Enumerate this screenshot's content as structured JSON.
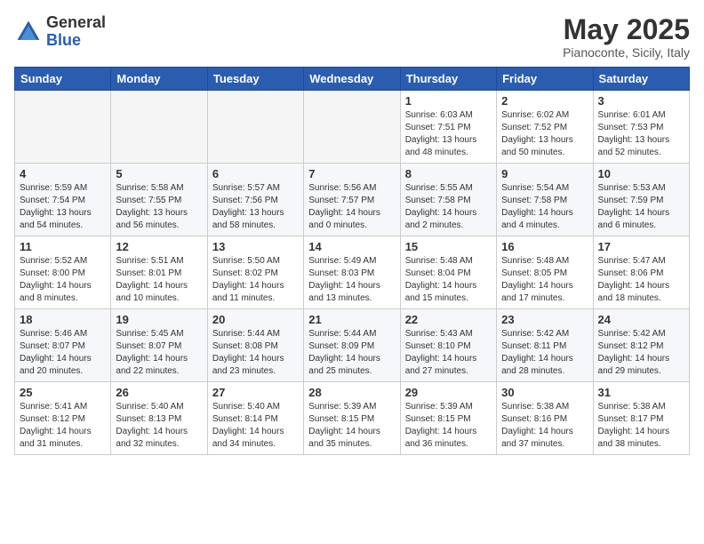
{
  "logo": {
    "general": "General",
    "blue": "Blue"
  },
  "title": "May 2025",
  "location": "Pianoconte, Sicily, Italy",
  "weekdays": [
    "Sunday",
    "Monday",
    "Tuesday",
    "Wednesday",
    "Thursday",
    "Friday",
    "Saturday"
  ],
  "weeks": [
    [
      {
        "day": "",
        "info": ""
      },
      {
        "day": "",
        "info": ""
      },
      {
        "day": "",
        "info": ""
      },
      {
        "day": "",
        "info": ""
      },
      {
        "day": "1",
        "info": "Sunrise: 6:03 AM\nSunset: 7:51 PM\nDaylight: 13 hours\nand 48 minutes."
      },
      {
        "day": "2",
        "info": "Sunrise: 6:02 AM\nSunset: 7:52 PM\nDaylight: 13 hours\nand 50 minutes."
      },
      {
        "day": "3",
        "info": "Sunrise: 6:01 AM\nSunset: 7:53 PM\nDaylight: 13 hours\nand 52 minutes."
      }
    ],
    [
      {
        "day": "4",
        "info": "Sunrise: 5:59 AM\nSunset: 7:54 PM\nDaylight: 13 hours\nand 54 minutes."
      },
      {
        "day": "5",
        "info": "Sunrise: 5:58 AM\nSunset: 7:55 PM\nDaylight: 13 hours\nand 56 minutes."
      },
      {
        "day": "6",
        "info": "Sunrise: 5:57 AM\nSunset: 7:56 PM\nDaylight: 13 hours\nand 58 minutes."
      },
      {
        "day": "7",
        "info": "Sunrise: 5:56 AM\nSunset: 7:57 PM\nDaylight: 14 hours\nand 0 minutes."
      },
      {
        "day": "8",
        "info": "Sunrise: 5:55 AM\nSunset: 7:58 PM\nDaylight: 14 hours\nand 2 minutes."
      },
      {
        "day": "9",
        "info": "Sunrise: 5:54 AM\nSunset: 7:58 PM\nDaylight: 14 hours\nand 4 minutes."
      },
      {
        "day": "10",
        "info": "Sunrise: 5:53 AM\nSunset: 7:59 PM\nDaylight: 14 hours\nand 6 minutes."
      }
    ],
    [
      {
        "day": "11",
        "info": "Sunrise: 5:52 AM\nSunset: 8:00 PM\nDaylight: 14 hours\nand 8 minutes."
      },
      {
        "day": "12",
        "info": "Sunrise: 5:51 AM\nSunset: 8:01 PM\nDaylight: 14 hours\nand 10 minutes."
      },
      {
        "day": "13",
        "info": "Sunrise: 5:50 AM\nSunset: 8:02 PM\nDaylight: 14 hours\nand 11 minutes."
      },
      {
        "day": "14",
        "info": "Sunrise: 5:49 AM\nSunset: 8:03 PM\nDaylight: 14 hours\nand 13 minutes."
      },
      {
        "day": "15",
        "info": "Sunrise: 5:48 AM\nSunset: 8:04 PM\nDaylight: 14 hours\nand 15 minutes."
      },
      {
        "day": "16",
        "info": "Sunrise: 5:48 AM\nSunset: 8:05 PM\nDaylight: 14 hours\nand 17 minutes."
      },
      {
        "day": "17",
        "info": "Sunrise: 5:47 AM\nSunset: 8:06 PM\nDaylight: 14 hours\nand 18 minutes."
      }
    ],
    [
      {
        "day": "18",
        "info": "Sunrise: 5:46 AM\nSunset: 8:07 PM\nDaylight: 14 hours\nand 20 minutes."
      },
      {
        "day": "19",
        "info": "Sunrise: 5:45 AM\nSunset: 8:07 PM\nDaylight: 14 hours\nand 22 minutes."
      },
      {
        "day": "20",
        "info": "Sunrise: 5:44 AM\nSunset: 8:08 PM\nDaylight: 14 hours\nand 23 minutes."
      },
      {
        "day": "21",
        "info": "Sunrise: 5:44 AM\nSunset: 8:09 PM\nDaylight: 14 hours\nand 25 minutes."
      },
      {
        "day": "22",
        "info": "Sunrise: 5:43 AM\nSunset: 8:10 PM\nDaylight: 14 hours\nand 27 minutes."
      },
      {
        "day": "23",
        "info": "Sunrise: 5:42 AM\nSunset: 8:11 PM\nDaylight: 14 hours\nand 28 minutes."
      },
      {
        "day": "24",
        "info": "Sunrise: 5:42 AM\nSunset: 8:12 PM\nDaylight: 14 hours\nand 29 minutes."
      }
    ],
    [
      {
        "day": "25",
        "info": "Sunrise: 5:41 AM\nSunset: 8:12 PM\nDaylight: 14 hours\nand 31 minutes."
      },
      {
        "day": "26",
        "info": "Sunrise: 5:40 AM\nSunset: 8:13 PM\nDaylight: 14 hours\nand 32 minutes."
      },
      {
        "day": "27",
        "info": "Sunrise: 5:40 AM\nSunset: 8:14 PM\nDaylight: 14 hours\nand 34 minutes."
      },
      {
        "day": "28",
        "info": "Sunrise: 5:39 AM\nSunset: 8:15 PM\nDaylight: 14 hours\nand 35 minutes."
      },
      {
        "day": "29",
        "info": "Sunrise: 5:39 AM\nSunset: 8:15 PM\nDaylight: 14 hours\nand 36 minutes."
      },
      {
        "day": "30",
        "info": "Sunrise: 5:38 AM\nSunset: 8:16 PM\nDaylight: 14 hours\nand 37 minutes."
      },
      {
        "day": "31",
        "info": "Sunrise: 5:38 AM\nSunset: 8:17 PM\nDaylight: 14 hours\nand 38 minutes."
      }
    ]
  ]
}
